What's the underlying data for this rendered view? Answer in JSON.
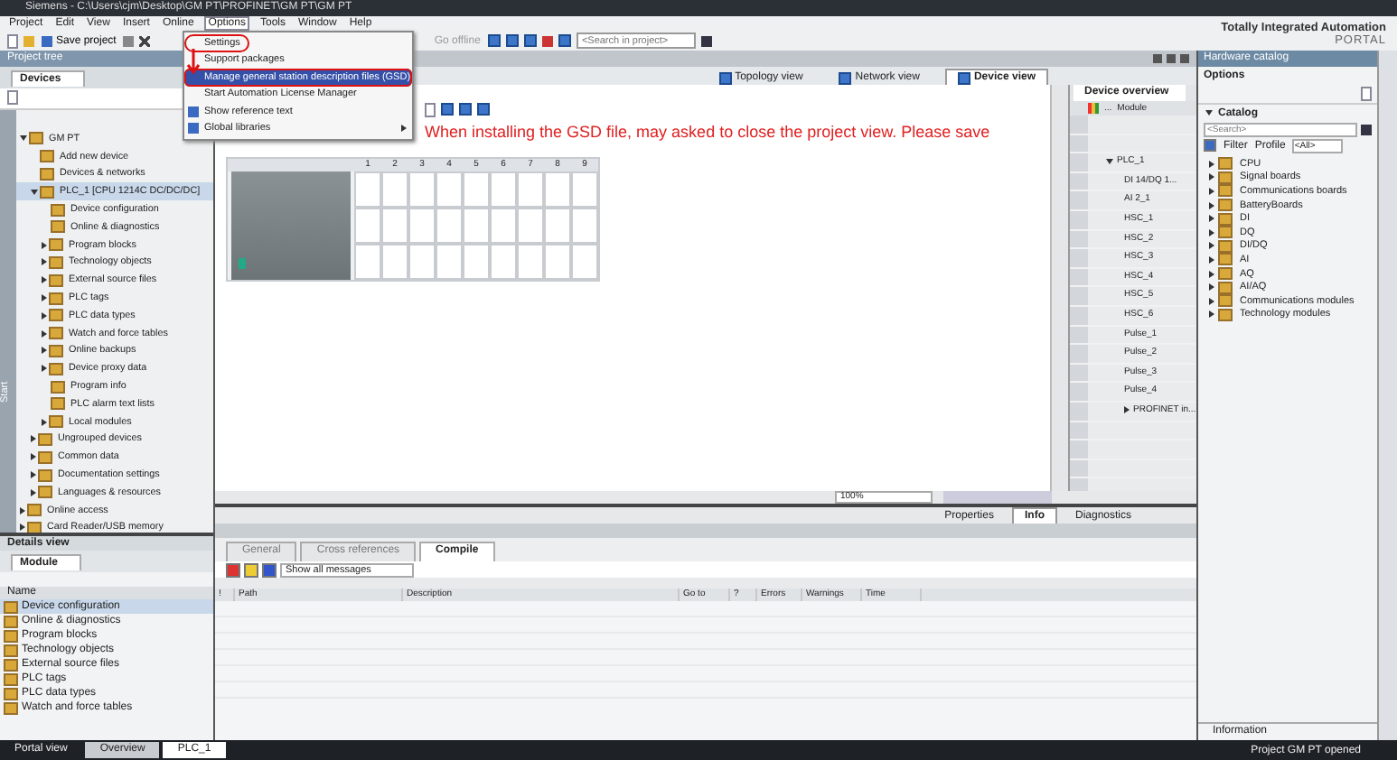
{
  "window": {
    "title": "Siemens - C:\\Users\\cjm\\Desktop\\GM PT\\PROFINET\\GM PT\\GM PT"
  },
  "menu": [
    {
      "label": "Project",
      "selected": false
    },
    {
      "label": "Edit",
      "selected": false
    },
    {
      "label": "View",
      "selected": false
    },
    {
      "label": "Insert",
      "selected": false
    },
    {
      "label": "Online",
      "selected": false
    },
    {
      "label": "Options",
      "selected": true
    },
    {
      "label": "Tools",
      "selected": false
    },
    {
      "label": "Window",
      "selected": false
    },
    {
      "label": "Help",
      "selected": false
    }
  ],
  "toolbar": {
    "save": "Save project",
    "go_offline": {
      "label": "Go offline",
      "disabled": true
    },
    "search": {
      "placeholder": "<Search in project>"
    }
  },
  "branding": {
    "line1": "Totally Integrated Automation",
    "line2": "PORTAL"
  },
  "options_menu": [
    {
      "label": "Settings",
      "selected": false,
      "circled": true,
      "kind": "plain",
      "submenu": false
    },
    {
      "label": "Support packages",
      "selected": false,
      "circled": false,
      "kind": "plain",
      "submenu": false
    },
    {
      "label": "Manage general station description files (GSD)",
      "selected": true,
      "circled": false,
      "kind": "plain",
      "submenu": false
    },
    {
      "label": "Start Automation License Manager",
      "selected": false,
      "circled": false,
      "kind": "plain",
      "submenu": false
    },
    {
      "label": "Show reference text",
      "selected": false,
      "circled": false,
      "kind": "with_icon",
      "submenu": false
    },
    {
      "label": "Global libraries",
      "selected": false,
      "circled": false,
      "kind": "with_icon",
      "submenu": true
    }
  ],
  "project_tree": {
    "title": "Project tree",
    "tab": "Devices",
    "side_tab": "Start",
    "items": [
      {
        "label": "GM PT",
        "expanded": true,
        "selected": false,
        "children": [
          {
            "label": "Add new device",
            "selected": false
          },
          {
            "label": "Devices & networks",
            "selected": false
          },
          {
            "label": "PLC_1 [CPU 1214C DC/DC/DC]",
            "expanded": true,
            "selected": true,
            "children": [
              {
                "label": "Device configuration",
                "selected": false
              },
              {
                "label": "Online & diagnostics",
                "selected": false
              },
              {
                "label": "Program blocks",
                "expanded": false,
                "selected": false
              },
              {
                "label": "Technology objects",
                "expanded": false,
                "selected": false
              },
              {
                "label": "External source files",
                "expanded": false,
                "selected": false
              },
              {
                "label": "PLC tags",
                "expanded": false,
                "selected": false
              },
              {
                "label": "PLC data types",
                "expanded": false,
                "selected": false
              },
              {
                "label": "Watch and force tables",
                "expanded": false,
                "selected": false
              },
              {
                "label": "Online backups",
                "expanded": false,
                "selected": false
              },
              {
                "label": "Device proxy data",
                "expanded": false,
                "selected": false
              },
              {
                "label": "Program info",
                "selected": false
              },
              {
                "label": "PLC alarm text lists",
                "selected": false
              },
              {
                "label": "Local modules",
                "expanded": false,
                "selected": false
              }
            ]
          },
          {
            "label": "Ungrouped devices",
            "expanded": false,
            "selected": false
          },
          {
            "label": "Common data",
            "expanded": false,
            "selected": false
          },
          {
            "label": "Documentation settings",
            "expanded": false,
            "selected": false
          },
          {
            "label": "Languages & resources",
            "expanded": false,
            "selected": false
          }
        ]
      },
      {
        "label": "Online access",
        "expanded": false,
        "selected": false
      },
      {
        "label": "Card Reader/USB memory",
        "expanded": false,
        "selected": false
      }
    ]
  },
  "view_tabs": [
    {
      "label": "Topology view",
      "selected": false
    },
    {
      "label": "Network view",
      "selected": false
    },
    {
      "label": "Device view",
      "selected": true
    }
  ],
  "annotation_note": "When installing the GSD file, may asked to close the project view. Please save",
  "rack": {
    "slots": [
      "1",
      "2",
      "3",
      "4",
      "5",
      "6",
      "7",
      "8",
      "9"
    ]
  },
  "device_overview": {
    "tab": "Device overview",
    "columns": [
      "...",
      "Module"
    ],
    "rows": [
      {
        "module": "PLC_1",
        "expanded": true,
        "children": [
          {
            "module": "DI 14/DQ 1..."
          },
          {
            "module": "AI 2_1"
          },
          {
            "module": "HSC_1"
          },
          {
            "module": "HSC_2"
          },
          {
            "module": "HSC_3"
          },
          {
            "module": "HSC_4"
          },
          {
            "module": "HSC_5"
          },
          {
            "module": "HSC_6"
          },
          {
            "module": "Pulse_1"
          },
          {
            "module": "Pulse_2"
          },
          {
            "module": "Pulse_3"
          },
          {
            "module": "Pulse_4"
          },
          {
            "module": "PROFINET in...",
            "expanded": false
          }
        ]
      }
    ]
  },
  "zoom": "100%",
  "details": {
    "title": "Details view",
    "tab": "Module",
    "column": "Name",
    "items": [
      "Device configuration",
      "Online & diagnostics",
      "Program blocks",
      "Technology objects",
      "External source files",
      "PLC tags",
      "PLC data types",
      "Watch and force tables"
    ]
  },
  "inspector": {
    "tabs": [
      {
        "label": "Properties",
        "selected": false
      },
      {
        "label": "Info",
        "selected": true
      },
      {
        "label": "Diagnostics",
        "selected": false
      }
    ],
    "subtabs": [
      {
        "label": "General",
        "selected": false
      },
      {
        "label": "Cross references",
        "selected": false
      },
      {
        "label": "Compile",
        "selected": true
      }
    ],
    "filter": "Show all messages",
    "columns": [
      "!",
      "Path",
      "Description",
      "Go to",
      "?",
      "Errors",
      "Warnings",
      "Time"
    ]
  },
  "catalog": {
    "title": "Hardware catalog",
    "options": "Options",
    "section": "Catalog",
    "search": {
      "placeholder": "<Search>"
    },
    "filter": {
      "label": "Filter",
      "checked": true
    },
    "profile_label": "Profile",
    "profile": "<All>",
    "items": [
      "CPU",
      "Signal boards",
      "Communications boards",
      "BatteryBoards",
      "DI",
      "DQ",
      "DI/DQ",
      "AI",
      "AQ",
      "AI/AQ",
      "Communications modules",
      "Technology modules"
    ],
    "information": "Information"
  },
  "status_bar": {
    "portal_view": "Portal view",
    "overview": "Overview",
    "editor": "PLC_1",
    "message": "Project GM PT opened"
  }
}
